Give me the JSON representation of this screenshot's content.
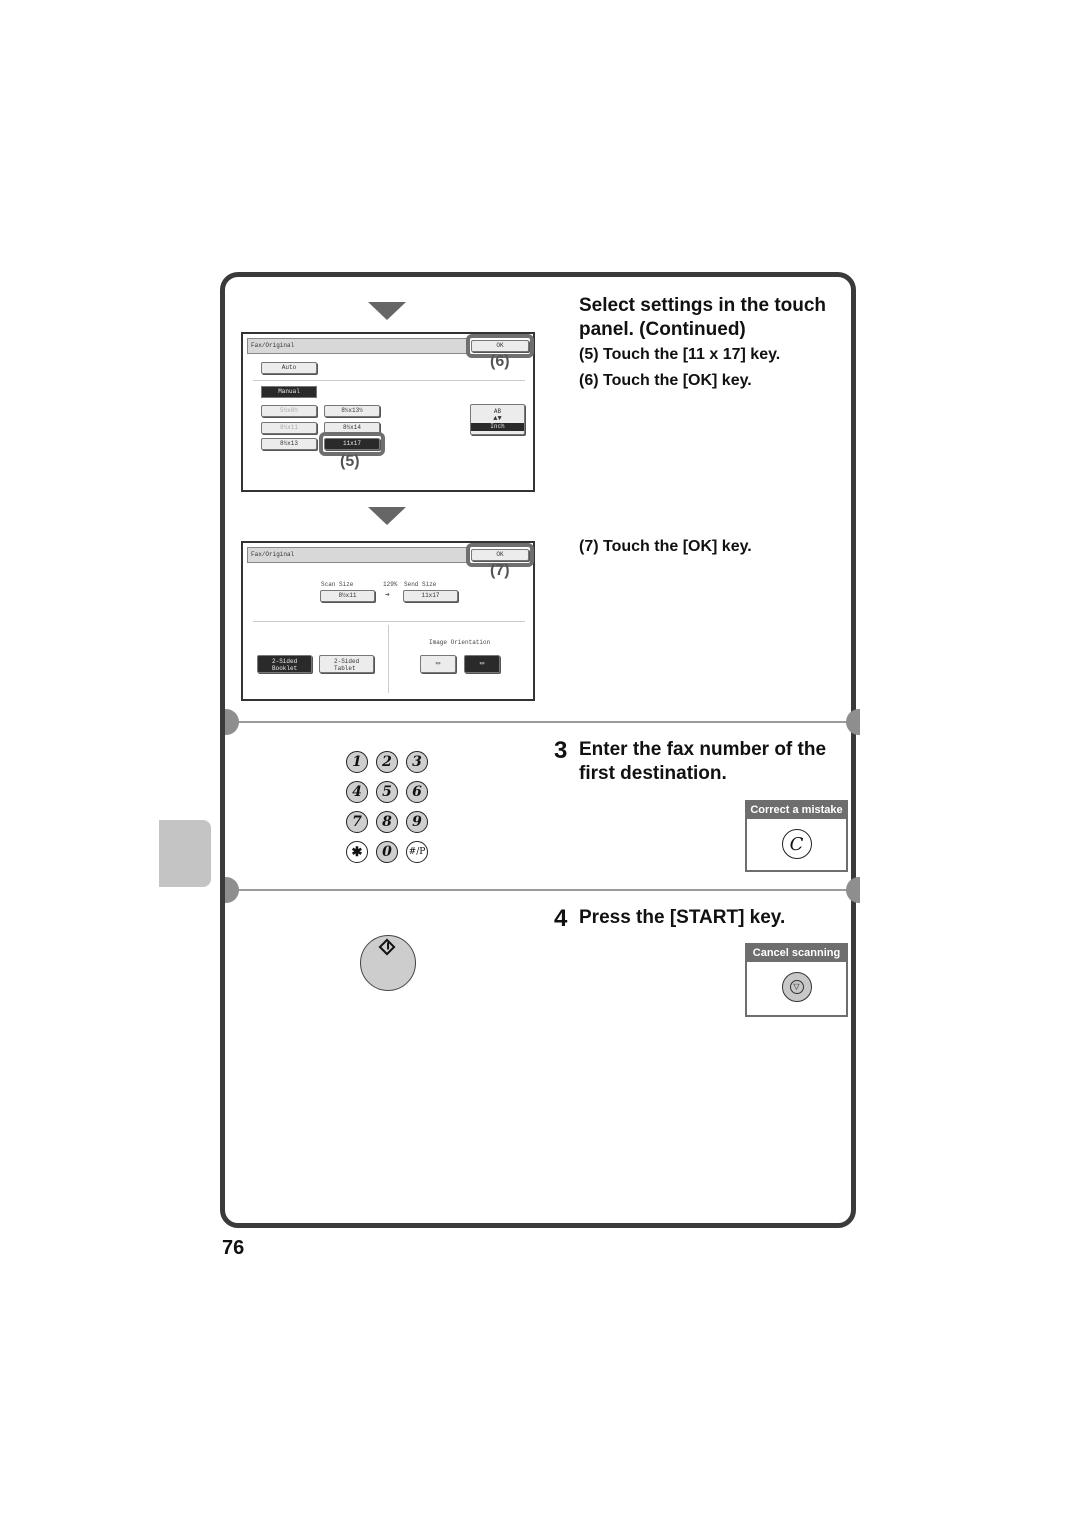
{
  "page_number": "76",
  "step2": {
    "heading": "Select settings in the touch panel. (Continued)",
    "heading_line1": "Select settings in the touch",
    "heading_line2": "panel. (Continued)",
    "sub5": "(5) Touch the [11 x 17] key.",
    "sub6": "(6) Touch the [OK] key.",
    "sub7": "(7) Touch the [OK] key."
  },
  "panel1": {
    "title": "Fax/Original",
    "ok_label": "OK",
    "auto_label": "Auto",
    "manual_label": "Manual",
    "sizes": [
      "5½x8½",
      "8½x13½",
      "8½x11",
      "8½x14",
      "8½x13",
      "11x17"
    ],
    "unit_top": "AB",
    "unit_bottom": "Inch",
    "callout_ok": "(6)",
    "callout_size": "(5)"
  },
  "panel2": {
    "title": "Fax/Original",
    "ok_label": "OK",
    "scan_size_label": "Scan Size",
    "ratio": "129%",
    "send_size_label": "Send Size",
    "scan_size_value": "8½x11",
    "send_size_value": "11x17",
    "booklet_label_1": "2-Sided",
    "booklet_label_2": "Booklet",
    "tablet_label_1": "2-Sided",
    "tablet_label_2": "Tablet",
    "orientation_label": "Image Orientation",
    "callout_ok": "(7)"
  },
  "step3": {
    "number": "3",
    "line1": "Enter the fax number of the",
    "line2": "first destination.",
    "keypad": [
      "1",
      "2",
      "3",
      "4",
      "5",
      "6",
      "7",
      "8",
      "9",
      "✱",
      "0",
      "#/P"
    ],
    "box_title": "Correct a mistake",
    "box_key": "C"
  },
  "step4": {
    "number": "4",
    "text": "Press the [START] key.",
    "box_title": "Cancel scanning"
  }
}
